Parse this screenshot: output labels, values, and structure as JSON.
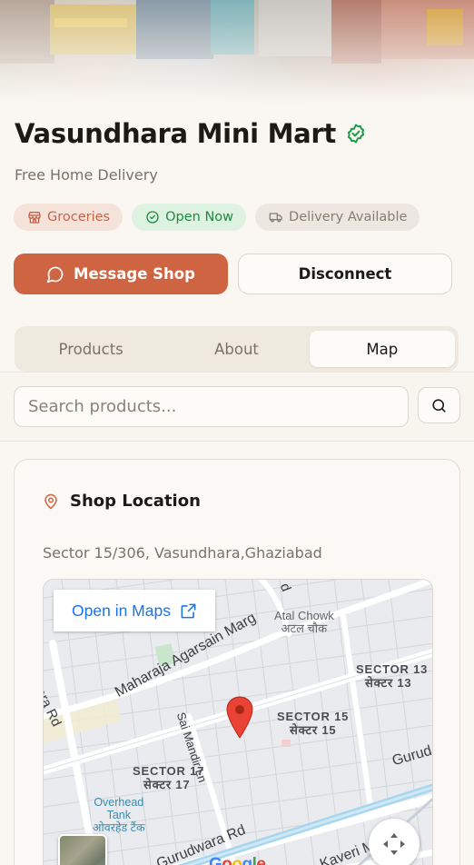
{
  "shop": {
    "name": "Vasundhara Mini Mart",
    "verified_icon": "verified-check-icon",
    "subtitle": "Free Home Delivery",
    "badges": [
      {
        "icon": "store-icon",
        "label": "Groceries",
        "color": "#c7614a"
      },
      {
        "icon": "check-circle-icon",
        "label": "Open Now",
        "color": "#1f8a3f"
      },
      {
        "icon": "truck-icon",
        "label": "Delivery Available",
        "color": "#857d72"
      }
    ]
  },
  "actions": {
    "message": {
      "icon": "chat-bubble-icon",
      "label": "Message Shop"
    },
    "disconnect": {
      "label": "Disconnect"
    }
  },
  "tabs": [
    {
      "label": "Products",
      "active": false
    },
    {
      "label": "About",
      "active": false
    },
    {
      "label": "Map",
      "active": true
    }
  ],
  "search": {
    "placeholder": "Search products...",
    "value": "",
    "icon": "search-icon"
  },
  "location": {
    "icon": "map-pin-icon",
    "title": "Shop Location",
    "address": "Sector 15/306, Vasundhara,Ghaziabad"
  },
  "map": {
    "open_in_maps": "Open in Maps",
    "open_icon": "external-link-icon",
    "labels": {
      "atal_chowk": "Atal Chowk",
      "atal_chowk_hi": "अटल चौक",
      "maharaja_road": "Maharaja Agarsain Marg",
      "sai_mandir": "Sai Mandir Ln",
      "vasundhara_rd": "ndhara Rd",
      "sector13": "SECTOR 13",
      "sector13_hi": "सेक्टर 13",
      "sector15": "SECTOR 15",
      "sector15_hi": "सेक्टर 15",
      "sector17": "SECTOR 17",
      "sector17_hi": "सेक्टर 17",
      "overhead_tank": "Overhead",
      "overhead_tank2": "Tank",
      "overhead_tank_hi": "ओवरहेड टैंक",
      "gurudwara_rd": "Gurudwara Rd",
      "gurud": "Gurud",
      "kaveri": "Kaveri M",
      "road_top": "d"
    },
    "pin_color": "#ea4335",
    "google_logo": "Google",
    "controls": {
      "move_icon": "move-arrows-icon",
      "layer_thumb": "satellite-layer-thumbnail"
    }
  },
  "colors": {
    "accent": "#cf6443",
    "background": "#faf7f2",
    "link_blue": "#1a73e8"
  }
}
